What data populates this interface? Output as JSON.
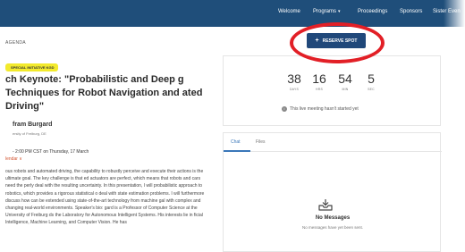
{
  "nav": {
    "items": [
      {
        "label": "Welcome",
        "has_caret": false
      },
      {
        "label": "Programs",
        "has_caret": true
      },
      {
        "label": "Proceedings",
        "has_caret": false
      },
      {
        "label": "Sponsors",
        "has_caret": false
      },
      {
        "label": "Sister Even",
        "has_caret": false
      }
    ],
    "caret_glyph": "▾",
    "background": "#1f4e7a"
  },
  "breadcrumb": "AGENDA",
  "badge": "SPECIAL INITIATIVE KGD",
  "session": {
    "title": "ch Keynote: \"Probabilistic and Deep g Techniques for Robot Navigation and ated Driving\"",
    "speaker_name": "fram Burgard",
    "speaker_affiliation": "ersity of Freiburg, DE",
    "datetime": "- 2:00 PM CST on Thursday, 17 March",
    "add_calendar": "lendar ∨",
    "description": "ous robots and automated driving, the capability to robustly perceive and execute their actions is the ultimate goal. The key challenge is that ed actuators are perfect, which means that robots and cars need the perly deal with the resulting uncertainty. In this presentation, I will probabilistic approach to robotics, which provides a rigorous statistical o deal with state estimation problems. I will furthermore discuss how can be extended using state-of-the-art technology from machine gal with complex and changing real-world environments. Speaker's bio: gard is a Professor of Computer Science at the University of Freiburg ds the Laboratory for Autonomous Intelligent Systems. His interests lie in ficial Intelligence, Machine Learning, and Computer Vision. He has"
  },
  "reserve_button": {
    "label": "RESERVE SPOT",
    "icon": "plus-icon"
  },
  "annotation": {
    "color": "#e21f26",
    "shape": "circle"
  },
  "countdown": {
    "units": [
      {
        "value": "38",
        "label": "DAYS"
      },
      {
        "value": "16",
        "label": "HRS"
      },
      {
        "value": "54",
        "label": "MIN"
      },
      {
        "value": "5",
        "label": "SEC"
      }
    ],
    "note": "This live meeting hasn't started yet",
    "note_icon": "info-icon"
  },
  "chat": {
    "tabs": [
      {
        "label": "Chat",
        "active": true
      },
      {
        "label": "Files",
        "active": false
      }
    ],
    "empty_icon": "inbox-icon",
    "empty_title": "No Messages",
    "empty_subtitle": "No messages have yet been sent."
  },
  "colors": {
    "accent": "#3a77b9",
    "button": "#20487a",
    "badge": "#f3ea2c",
    "link": "#d35430"
  }
}
